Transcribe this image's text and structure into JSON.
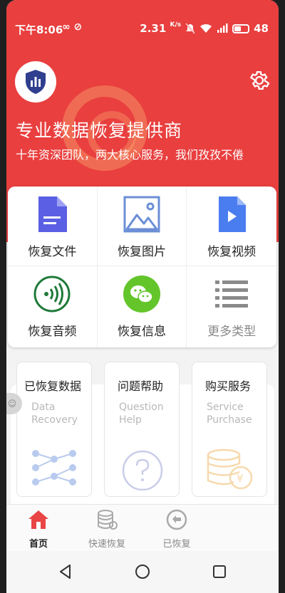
{
  "status_bar": {
    "time": "下午8:06",
    "left_icons": "∞ ⊘",
    "net_speed": "2.31",
    "net_unit": "K/s",
    "battery_level": "48"
  },
  "header": {
    "title": "专业数据恢复提供商",
    "subtitle": "十年资深团队，两大核心服务，我们孜孜不倦"
  },
  "categories": [
    {
      "label": "恢复文件",
      "icon": "file-icon"
    },
    {
      "label": "恢复图片",
      "icon": "image-icon"
    },
    {
      "label": "恢复视频",
      "icon": "video-icon"
    },
    {
      "label": "恢复音频",
      "icon": "audio-icon"
    },
    {
      "label": "恢复信息",
      "icon": "wechat-icon"
    },
    {
      "label": "更多类型",
      "icon": "list-icon"
    }
  ],
  "services": [
    {
      "title": "已恢复数据",
      "en1": "Data",
      "en2": "Recovery"
    },
    {
      "title": "问题帮助",
      "en1": "Question",
      "en2": "Help"
    },
    {
      "title": "购买服务",
      "en1": "Service",
      "en2": "Purchase"
    }
  ],
  "tabs": [
    {
      "label": "首页",
      "active": true
    },
    {
      "label": "快速恢复",
      "active": false
    },
    {
      "label": "已恢复",
      "active": false
    }
  ],
  "colors": {
    "brand_red": "#e93f3f",
    "file_icon": "#5b5fe3",
    "image_icon": "#6b8fd6",
    "video_icon": "#4a7df0",
    "audio_icon": "#1f7a3a",
    "wechat_icon": "#63c52a"
  }
}
